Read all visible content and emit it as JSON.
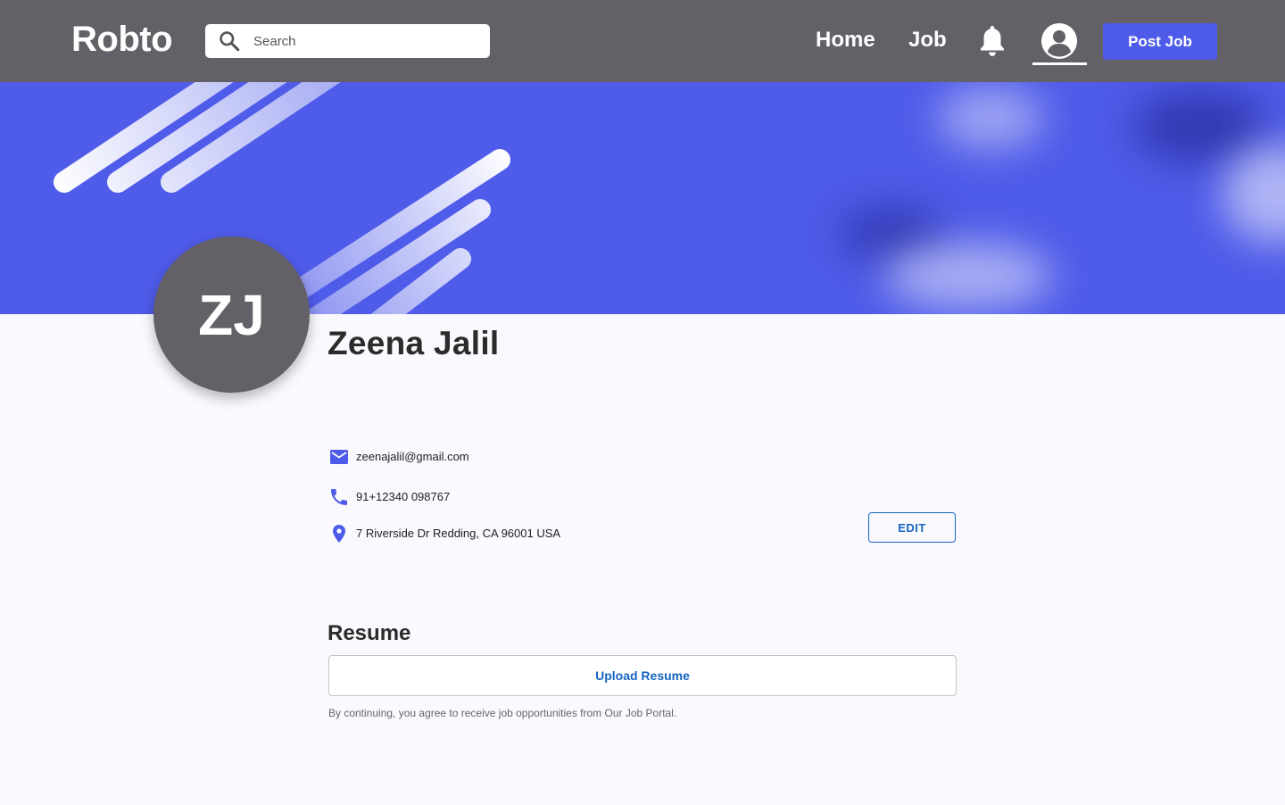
{
  "header": {
    "logo": "Robto",
    "search": {
      "placeholder": "Search",
      "value": ""
    },
    "nav": {
      "home": "Home",
      "job": "Job"
    },
    "post_job_label": "Post Job",
    "icons": {
      "search": "search-icon",
      "notifications": "bell-icon",
      "profile": "account-circle-icon"
    }
  },
  "profile": {
    "initials": "ZJ",
    "name": "Zeena Jalil",
    "email": "zeenajalil@gmail.com",
    "phone": "91+12340 098767",
    "address": "7 Riverside Dr Redding, CA 96001 USA",
    "edit_label": "EDIT"
  },
  "resume": {
    "title": "Resume",
    "upload_label": "Upload Resume",
    "disclaimer": "By continuing, you agree to receive job opportunities from Our Job Portal."
  },
  "colors": {
    "topbar": "#636167",
    "accent": "#4e5be9",
    "banner": "#4f5be9",
    "link_blue": "#1565c0",
    "page_bg": "#f9f9fe"
  }
}
